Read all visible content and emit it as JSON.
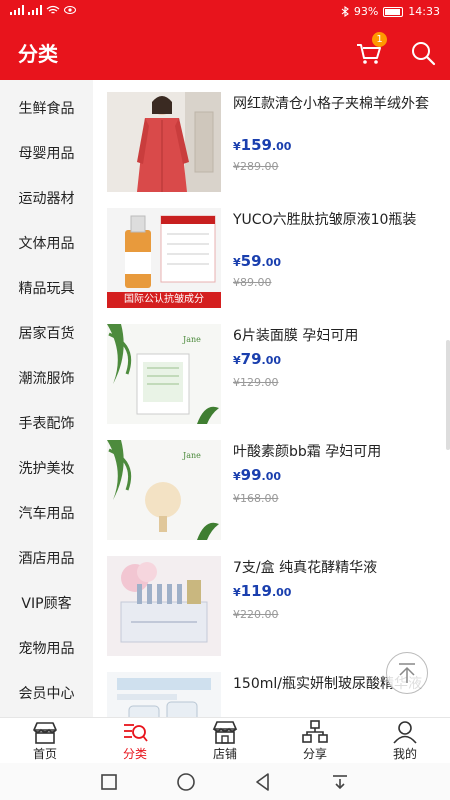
{
  "status_bar": {
    "battery": "93%",
    "time": "14:33"
  },
  "header": {
    "title": "分类",
    "cart_count": "1"
  },
  "sidebar": {
    "items": [
      {
        "label": "生鲜食品"
      },
      {
        "label": "母婴用品"
      },
      {
        "label": "运动器材"
      },
      {
        "label": "文体用品"
      },
      {
        "label": "精品玩具"
      },
      {
        "label": "居家百货"
      },
      {
        "label": "潮流服饰"
      },
      {
        "label": "手表配饰"
      },
      {
        "label": "洗护美妆"
      },
      {
        "label": "汽车用品"
      },
      {
        "label": "酒店用品"
      },
      {
        "label": "VIP顾客"
      },
      {
        "label": "宠物用品"
      },
      {
        "label": "会员中心"
      }
    ]
  },
  "products": [
    {
      "name": "网红款清仓小格子夹棉羊绒外套",
      "currency": "¥",
      "price_int": "159",
      "price_dec": ".00",
      "old_price": "¥289.00"
    },
    {
      "name": "YUCO六胜肽抗皱原液10瓶装",
      "currency": "¥",
      "price_int": "59",
      "price_dec": ".00",
      "old_price": "¥89.00",
      "image_text": "国际公认抗皱成分"
    },
    {
      "name": "6片装面膜  孕妇可用",
      "currency": "¥",
      "price_int": "79",
      "price_dec": ".00",
      "old_price": "¥129.00"
    },
    {
      "name": "叶酸素颜bb霜  孕妇可用",
      "currency": "¥",
      "price_int": "99",
      "price_dec": ".00",
      "old_price": "¥168.00"
    },
    {
      "name": "7支/盒 纯真花酵精华液",
      "currency": "¥",
      "price_int": "119",
      "price_dec": ".00",
      "old_price": "¥220.00"
    },
    {
      "name": "150ml/瓶实妍制玻尿酸精华液"
    }
  ],
  "bottom_nav": {
    "items": [
      {
        "label": "首页"
      },
      {
        "label": "分类"
      },
      {
        "label": "店铺"
      },
      {
        "label": "分享"
      },
      {
        "label": "我的"
      }
    ]
  },
  "colors": {
    "brand": "#e8141c",
    "price": "#1a3fae",
    "sidebar_bg": "#f4f4f4",
    "badge": "#ff9800"
  }
}
